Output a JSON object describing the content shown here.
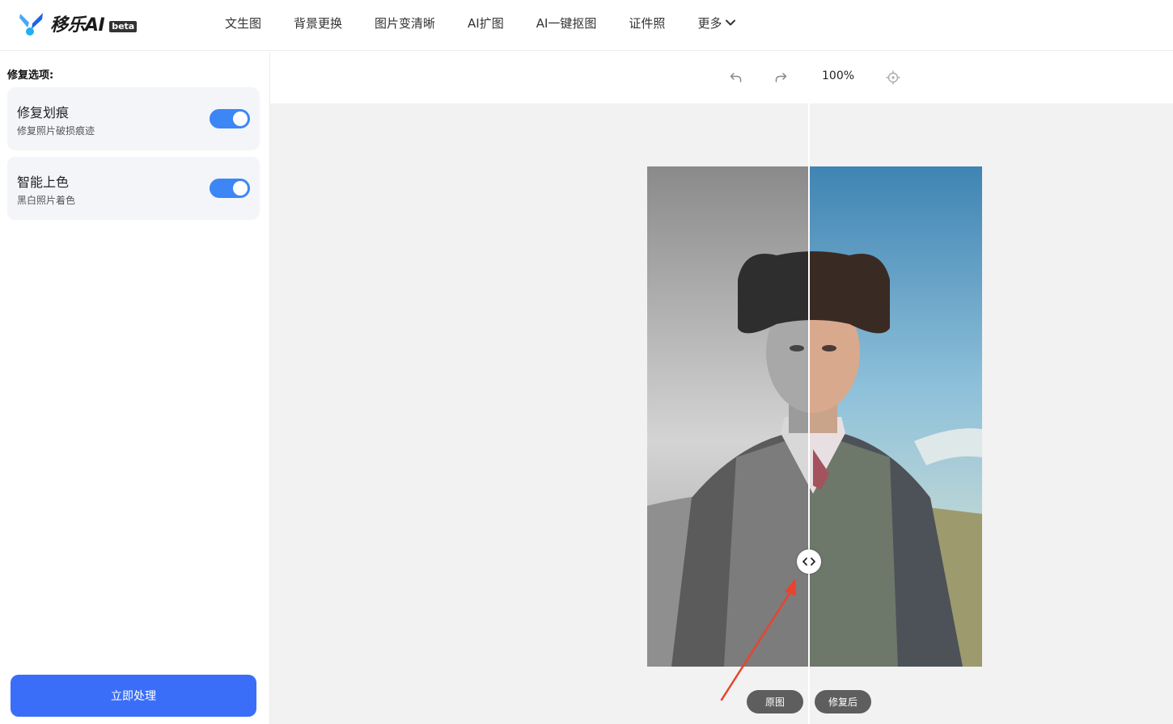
{
  "app": {
    "name": "移乐AI",
    "badge": "beta"
  },
  "nav": {
    "items": [
      "文生图",
      "背景更换",
      "图片变清晰",
      "AI扩图",
      "AI一键抠图",
      "证件照"
    ],
    "more_label": "更多"
  },
  "sidebar": {
    "section_title": "修复选项:",
    "options": [
      {
        "title": "修复划痕",
        "desc": "修复照片破损痕迹",
        "enabled": true
      },
      {
        "title": "智能上色",
        "desc": "黑白照片着色",
        "enabled": true
      }
    ],
    "process_button": "立即处理"
  },
  "toolbar": {
    "zoom": "100%"
  },
  "compare": {
    "original_label": "原图",
    "restored_label": "修复后"
  },
  "colors": {
    "accent": "#3b6ef8",
    "toggle_on": "#3d86f6",
    "annotation_arrow": "#e8432e"
  }
}
